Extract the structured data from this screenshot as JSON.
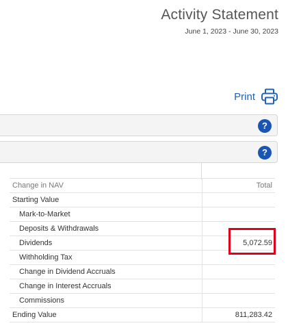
{
  "header": {
    "title": "Activity Statement",
    "period": "June 1, 2023 - June 30, 2023"
  },
  "print": {
    "label": "Print",
    "icon": "printer-icon",
    "color": "#1f62b7"
  },
  "sections": [
    {
      "help_label": "?"
    },
    {
      "help_label": "?"
    }
  ],
  "nav_table": {
    "header": {
      "label": "Change in NAV",
      "value": "Total"
    },
    "rows": [
      {
        "label": "Starting Value",
        "value": ""
      },
      {
        "label": "Mark-to-Market",
        "value": ""
      },
      {
        "label": "Deposits & Withdrawals",
        "value": ""
      },
      {
        "label": "Dividends",
        "value": "5,072.59"
      },
      {
        "label": "Withholding Tax",
        "value": ""
      },
      {
        "label": "Change in Dividend Accruals",
        "value": ""
      },
      {
        "label": "Change in Interest Accruals",
        "value": ""
      },
      {
        "label": "Commissions",
        "value": ""
      },
      {
        "label": "Ending Value",
        "value": "811,283.42"
      }
    ]
  },
  "highlight_color": "#e0001b"
}
